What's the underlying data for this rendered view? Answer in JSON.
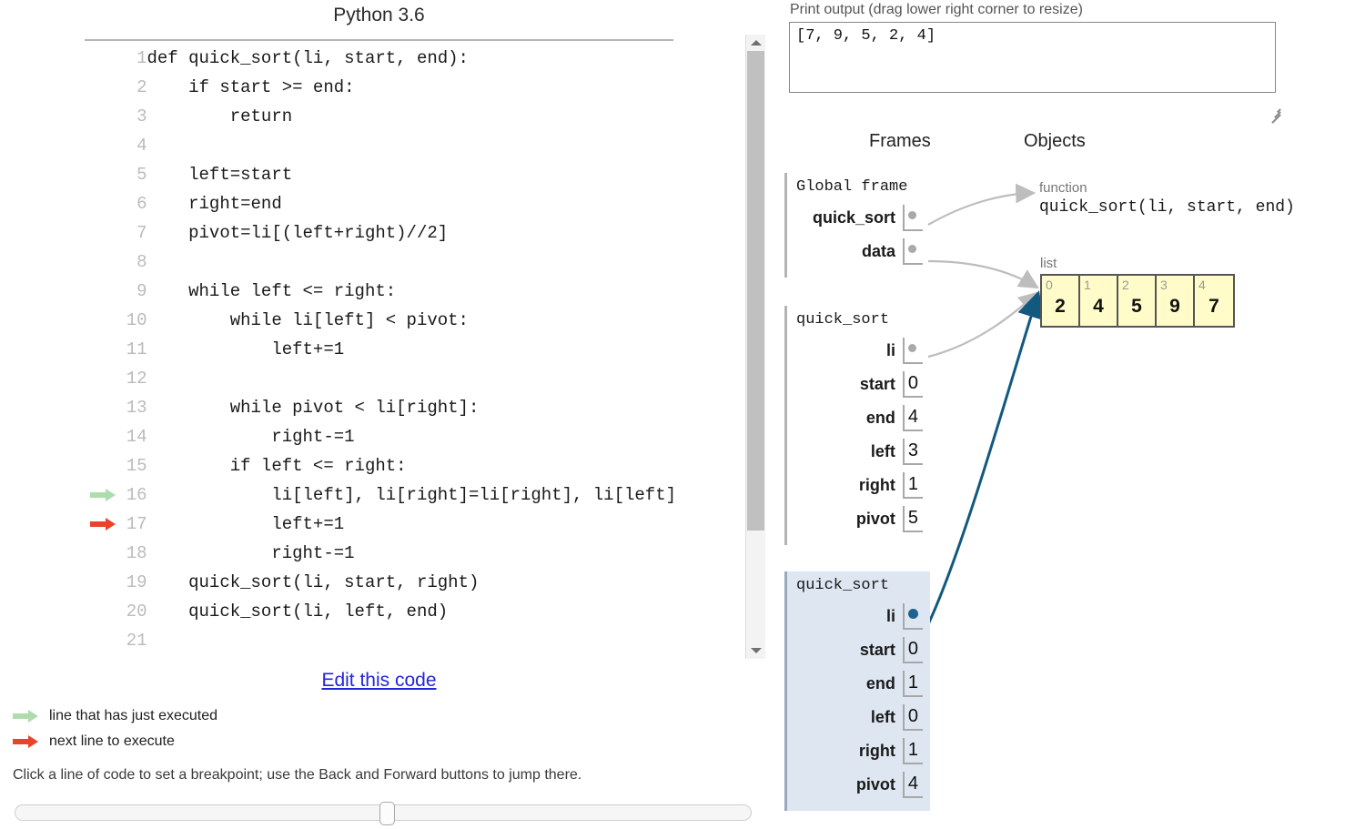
{
  "code_panel": {
    "language_title": "Python 3.6",
    "lines": [
      {
        "n": "1",
        "text": "def quick_sort(li, start, end):",
        "marker": ""
      },
      {
        "n": "2",
        "text": "    if start >= end:",
        "marker": ""
      },
      {
        "n": "3",
        "text": "        return",
        "marker": ""
      },
      {
        "n": "4",
        "text": "",
        "marker": ""
      },
      {
        "n": "5",
        "text": "    left=start",
        "marker": ""
      },
      {
        "n": "6",
        "text": "    right=end",
        "marker": ""
      },
      {
        "n": "7",
        "text": "    pivot=li[(left+right)//2]",
        "marker": ""
      },
      {
        "n": "8",
        "text": "",
        "marker": ""
      },
      {
        "n": "9",
        "text": "    while left <= right:",
        "marker": ""
      },
      {
        "n": "10",
        "text": "        while li[left] < pivot:",
        "marker": ""
      },
      {
        "n": "11",
        "text": "            left+=1",
        "marker": ""
      },
      {
        "n": "12",
        "text": "",
        "marker": ""
      },
      {
        "n": "13",
        "text": "        while pivot < li[right]:",
        "marker": ""
      },
      {
        "n": "14",
        "text": "            right-=1",
        "marker": ""
      },
      {
        "n": "15",
        "text": "        if left <= right:",
        "marker": ""
      },
      {
        "n": "16",
        "text": "            li[left], li[right]=li[right], li[left]",
        "marker": "executed"
      },
      {
        "n": "17",
        "text": "            left+=1",
        "marker": "next"
      },
      {
        "n": "18",
        "text": "            right-=1",
        "marker": ""
      },
      {
        "n": "19",
        "text": "    quick_sort(li, start, right)",
        "marker": ""
      },
      {
        "n": "20",
        "text": "    quick_sort(li, left, end)",
        "marker": ""
      },
      {
        "n": "21",
        "text": "",
        "marker": ""
      }
    ],
    "edit_link_label": "Edit this code",
    "legend": {
      "executed_label": "line that has just executed",
      "next_label": "next line to execute",
      "executed_color": "#aedcae",
      "next_color": "#e8442a"
    },
    "hint": "Click a line of code to set a breakpoint; use the Back and Forward buttons to jump there."
  },
  "viz_panel": {
    "print_output_label": "Print output (drag lower right corner to resize)",
    "print_output_value": "[7, 9, 5, 2, 4]",
    "frames_heading": "Frames",
    "objects_heading": "Objects",
    "frames": [
      {
        "title": "Global frame",
        "active": false,
        "vars": [
          {
            "name": "quick_sort",
            "value": "",
            "is_pointer": true,
            "pointer_color": "gray"
          },
          {
            "name": "data",
            "value": "",
            "is_pointer": true,
            "pointer_color": "gray"
          }
        ]
      },
      {
        "title": "quick_sort",
        "active": false,
        "vars": [
          {
            "name": "li",
            "value": "",
            "is_pointer": true,
            "pointer_color": "gray"
          },
          {
            "name": "start",
            "value": "0",
            "is_pointer": false
          },
          {
            "name": "end",
            "value": "4",
            "is_pointer": false
          },
          {
            "name": "left",
            "value": "3",
            "is_pointer": false
          },
          {
            "name": "right",
            "value": "1",
            "is_pointer": false
          },
          {
            "name": "pivot",
            "value": "5",
            "is_pointer": false
          }
        ]
      },
      {
        "title": "quick_sort",
        "active": true,
        "vars": [
          {
            "name": "li",
            "value": "",
            "is_pointer": true,
            "pointer_color": "blue"
          },
          {
            "name": "start",
            "value": "0",
            "is_pointer": false
          },
          {
            "name": "end",
            "value": "1",
            "is_pointer": false
          },
          {
            "name": "left",
            "value": "0",
            "is_pointer": false
          },
          {
            "name": "right",
            "value": "1",
            "is_pointer": false
          },
          {
            "name": "pivot",
            "value": "4",
            "is_pointer": false
          }
        ]
      }
    ],
    "objects": {
      "function": {
        "type_label": "function",
        "signature": "quick_sort(li, start, end)"
      },
      "list": {
        "type_label": "list",
        "indices": [
          "0",
          "1",
          "2",
          "3",
          "4"
        ],
        "values": [
          "2",
          "4",
          "5",
          "9",
          "7"
        ]
      }
    },
    "colors": {
      "list_fill": "#fffcc9",
      "list_border": "#555555",
      "active_frame_fill": "#dde6f1",
      "active_pointer": "#1f6290",
      "inactive_pointer": "#a9a9a9"
    }
  }
}
